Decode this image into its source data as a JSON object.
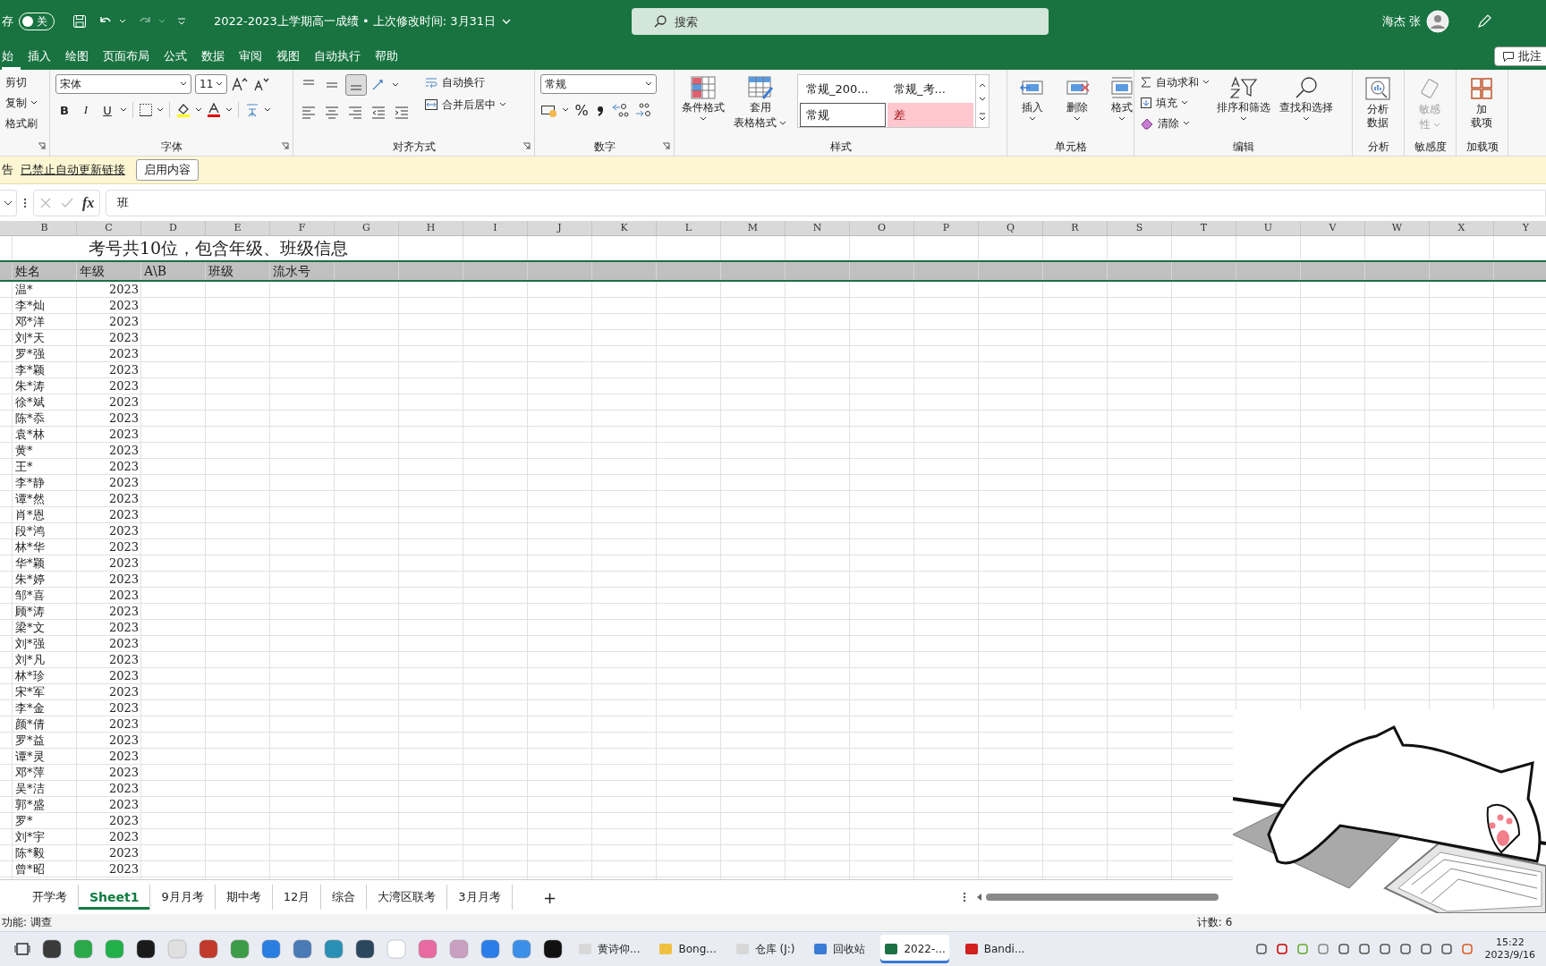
{
  "title_bar": {
    "autosave_label": "存",
    "autosave": {
      "label": "关",
      "on": false
    },
    "redo_disabled": true,
    "document_title": "2022-2023上学期高一成绩 • 上次修改时间: 3月31日",
    "search_placeholder": "搜索",
    "user_name": "海杰 张"
  },
  "menu_tabs": [
    {
      "label": "始",
      "selected": true
    },
    {
      "label": "插入",
      "selected": false
    },
    {
      "label": "绘图",
      "selected": false
    },
    {
      "label": "页面布局",
      "selected": false
    },
    {
      "label": "公式",
      "selected": false
    },
    {
      "label": "数据",
      "selected": false
    },
    {
      "label": "审阅",
      "selected": false
    },
    {
      "label": "视图",
      "selected": false
    },
    {
      "label": "自动执行",
      "selected": false
    },
    {
      "label": "帮助",
      "selected": false
    }
  ],
  "comments_button": "批注",
  "ribbon": {
    "clipboard": {
      "cut": "剪切",
      "copy": "复制",
      "format_painter": "格式刷"
    },
    "font": {
      "font_name": "宋体",
      "font_size": "11",
      "bold": "B",
      "italic": "I",
      "underline": "U",
      "label": "字体"
    },
    "alignment": {
      "wrap_text": "自动换行",
      "merge_center": "合并后居中",
      "label": "对齐方式"
    },
    "number": {
      "format": "常规",
      "percent": "%",
      "label": "数字"
    },
    "styles": {
      "conditional": "条件格式",
      "table_format": [
        "套用",
        "表格格式"
      ],
      "gallery": [
        {
          "label": "常规_200...",
          "selected": false,
          "color": "#ffffff"
        },
        {
          "label": "常规_考...",
          "selected": false,
          "color": "#ffffff"
        },
        {
          "label": "常规",
          "selected": true,
          "color": "#ffffff"
        },
        {
          "label": "差",
          "selected": false,
          "color": "#ffc7ce"
        }
      ],
      "label": "样式"
    },
    "cells": {
      "insert": "插入",
      "delete": "删除",
      "format": "格式",
      "label": "单元格"
    },
    "editing": {
      "autosum": "自动求和",
      "fill": "填充",
      "clear": "清除",
      "sort_filter": "排序和筛选",
      "find_select": "查找和选择",
      "label": "编辑"
    },
    "analysis": {
      "button": [
        "分析",
        "数据"
      ],
      "label": "分析"
    },
    "sensitivity": {
      "button": [
        "敏感",
        "性"
      ],
      "disabled": true,
      "label": "敏感度"
    },
    "addins": {
      "button": [
        "加",
        "载项"
      ],
      "label": "加载项"
    }
  },
  "message_bar": {
    "prefix": "告",
    "link": "已禁止自动更新链接",
    "button": "启用内容"
  },
  "formula_bar": {
    "function_label": "fx",
    "value": "班"
  },
  "sheet": {
    "columns": [
      "B",
      "C",
      "D",
      "E",
      "F",
      "G",
      "H",
      "I",
      "J",
      "K",
      "L",
      "M",
      "N",
      "O",
      "P",
      "Q",
      "R",
      "S",
      "T",
      "U",
      "V",
      "W",
      "X",
      "Y"
    ],
    "title": "考号共10位，包含年级、班级信息",
    "headers": [
      "姓名",
      "年级",
      "A\\B",
      "班级",
      "流水号"
    ],
    "rows": [
      [
        "温*",
        "2023"
      ],
      [
        "李*灿",
        "2023"
      ],
      [
        "邓*洋",
        "2023"
      ],
      [
        "刘*天",
        "2023"
      ],
      [
        "罗*强",
        "2023"
      ],
      [
        "李*颖",
        "2023"
      ],
      [
        "朱*涛",
        "2023"
      ],
      [
        "徐*斌",
        "2023"
      ],
      [
        "陈*忝",
        "2023"
      ],
      [
        "袁*林",
        "2023"
      ],
      [
        "黄*",
        "2023"
      ],
      [
        "王*",
        "2023"
      ],
      [
        "李*静",
        "2023"
      ],
      [
        "谭*然",
        "2023"
      ],
      [
        "肖*恩",
        "2023"
      ],
      [
        "段*鸿",
        "2023"
      ],
      [
        "林*华",
        "2023"
      ],
      [
        "华*颖",
        "2023"
      ],
      [
        "朱*婷",
        "2023"
      ],
      [
        "邹*喜",
        "2023"
      ],
      [
        "顾*涛",
        "2023"
      ],
      [
        "梁*文",
        "2023"
      ],
      [
        "刘*强",
        "2023"
      ],
      [
        "刘*凡",
        "2023"
      ],
      [
        "林*珍",
        "2023"
      ],
      [
        "宋*军",
        "2023"
      ],
      [
        "李*金",
        "2023"
      ],
      [
        "颜*倩",
        "2023"
      ],
      [
        "罗*益",
        "2023"
      ],
      [
        "谭*灵",
        "2023"
      ],
      [
        "邓*萍",
        "2023"
      ],
      [
        "吴*洁",
        "2023"
      ],
      [
        "郭*盛",
        "2023"
      ],
      [
        "罗*",
        "2023"
      ],
      [
        "刘*宇",
        "2023"
      ],
      [
        "陈*毅",
        "2023"
      ],
      [
        "曾*昭",
        "2023"
      ]
    ]
  },
  "sheet_tabs": [
    {
      "label": "开学考",
      "selected": false
    },
    {
      "label": "Sheet1",
      "selected": true
    },
    {
      "label": "9月月考",
      "selected": false
    },
    {
      "label": "期中考",
      "selected": false
    },
    {
      "label": "12月",
      "selected": false
    },
    {
      "label": "综合",
      "selected": false
    },
    {
      "label": "大湾区联考",
      "selected": false
    },
    {
      "label": "3月月考",
      "selected": false
    }
  ],
  "add_sheet": "+",
  "status_bar": {
    "left": "功能: 调查",
    "count": "计数: 6"
  },
  "taskbar": {
    "apps": [
      {
        "label": "黄诗仰...",
        "selected": false
      },
      {
        "label": "Bong...",
        "selected": false
      },
      {
        "label": "仓库 (J:)",
        "selected": false
      },
      {
        "label": "回收站",
        "selected": false
      },
      {
        "label": "2022-...",
        "selected": true
      },
      {
        "label": "Bandi...",
        "selected": false
      }
    ],
    "time": "15:22",
    "date": "2023/9/16"
  }
}
